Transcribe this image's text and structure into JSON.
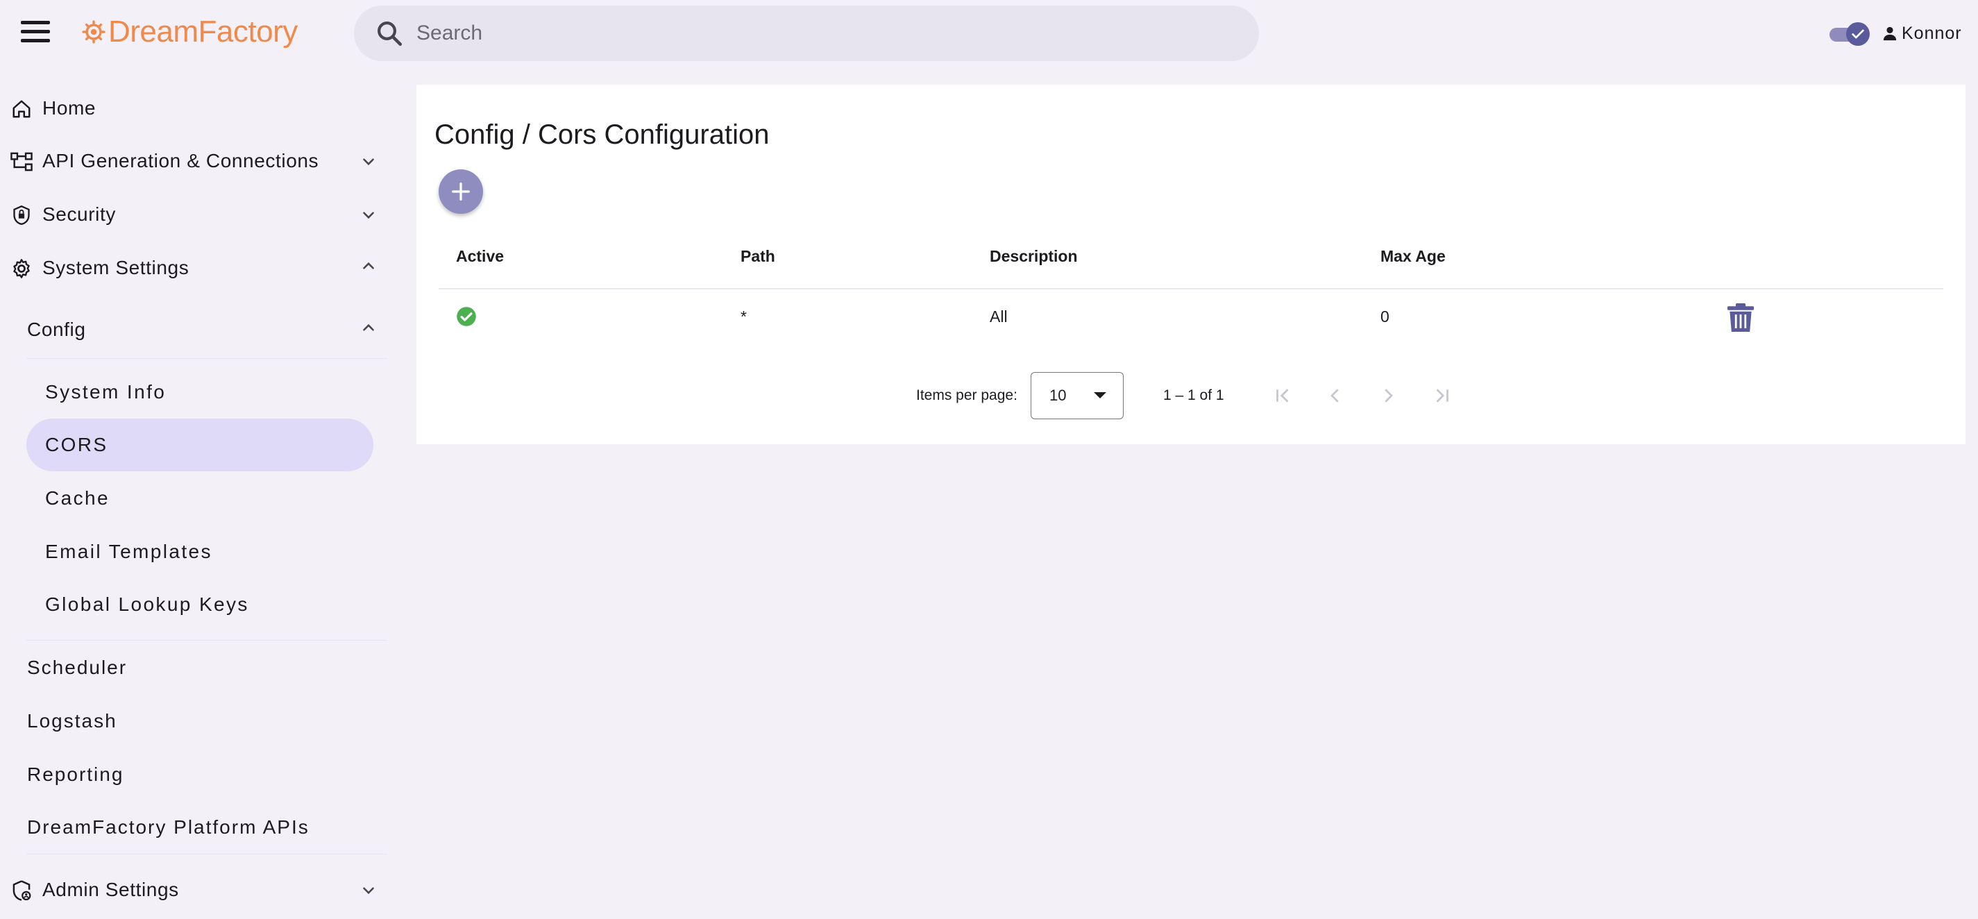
{
  "header": {
    "logo_text": "DreamFactory",
    "search_placeholder": "Search",
    "user_name": "Konnor"
  },
  "sidebar": {
    "home": "Home",
    "api_generation": "API Generation & Connections",
    "security": "Security",
    "system_settings": "System Settings",
    "config": "Config",
    "config_items": [
      "System Info",
      "CORS",
      "Cache",
      "Email Templates",
      "Global Lookup Keys"
    ],
    "active_item": "CORS",
    "scheduler": "Scheduler",
    "logstash": "Logstash",
    "reporting": "Reporting",
    "platform_apis": "DreamFactory Platform APIs",
    "admin_settings": "Admin Settings"
  },
  "main": {
    "title": "Config / Cors Configuration",
    "columns": [
      "Active",
      "Path",
      "Description",
      "Max Age"
    ],
    "rows": [
      {
        "active": true,
        "path": "*",
        "description": "All",
        "max_age": "0"
      }
    ],
    "pagination": {
      "items_per_page_label": "Items per page:",
      "items_per_page": "10",
      "range": "1 – 1 of 1"
    }
  },
  "colors": {
    "accent": "#8f8cc0",
    "logo": "#f08a4b",
    "active_nav_bg": "#dedaf8",
    "active_status": "#4caf50",
    "trash": "#5a5b9c"
  },
  "icons": {
    "menu": "hamburger-icon",
    "search": "search-icon",
    "user": "person-icon",
    "add": "plus-icon",
    "delete": "trash-icon",
    "active_status": "check-circle-icon"
  }
}
